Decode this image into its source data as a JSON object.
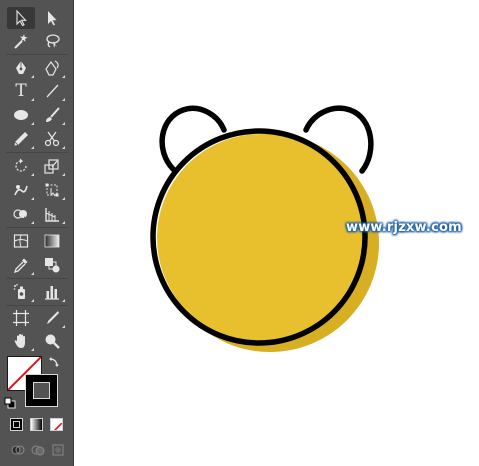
{
  "toolbar": {
    "tools": [
      {
        "name": "selection-tool",
        "icon": "selection-arrow-icon",
        "active": true
      },
      {
        "name": "direct-selection-tool",
        "icon": "direct-selection-arrow-icon"
      },
      {
        "name": "magic-wand-tool",
        "icon": "magic-wand-icon"
      },
      {
        "name": "lasso-tool",
        "icon": "lasso-icon"
      },
      {
        "name": "pen-tool",
        "icon": "pen-icon"
      },
      {
        "name": "curvature-tool",
        "icon": "curvature-pen-icon"
      },
      {
        "name": "type-tool",
        "icon": "type-icon",
        "glyph": "T"
      },
      {
        "name": "line-segment-tool",
        "icon": "line-segment-icon"
      },
      {
        "name": "ellipse-tool",
        "icon": "ellipse-icon"
      },
      {
        "name": "paintbrush-tool",
        "icon": "paintbrush-icon"
      },
      {
        "name": "pencil-tool",
        "icon": "pencil-icon"
      },
      {
        "name": "scissors-tool",
        "icon": "scissors-icon"
      },
      {
        "name": "rotate-tool",
        "icon": "rotate-icon"
      },
      {
        "name": "scale-tool",
        "icon": "scale-icon"
      },
      {
        "name": "warp-tool",
        "icon": "warp-icon"
      },
      {
        "name": "free-transform-tool",
        "icon": "free-transform-icon"
      },
      {
        "name": "shape-builder-tool",
        "icon": "shape-builder-icon"
      },
      {
        "name": "perspective-grid-tool",
        "icon": "perspective-grid-icon"
      },
      {
        "name": "mesh-tool",
        "icon": "mesh-icon"
      },
      {
        "name": "gradient-tool",
        "icon": "gradient-icon"
      },
      {
        "name": "eyedropper-tool",
        "icon": "eyedropper-icon"
      },
      {
        "name": "blend-tool",
        "icon": "blend-icon"
      },
      {
        "name": "symbol-sprayer-tool",
        "icon": "symbol-sprayer-icon"
      },
      {
        "name": "column-graph-tool",
        "icon": "column-graph-icon"
      },
      {
        "name": "artboard-tool",
        "icon": "artboard-icon"
      },
      {
        "name": "slice-tool",
        "icon": "slice-icon"
      },
      {
        "name": "hand-tool",
        "icon": "hand-icon"
      },
      {
        "name": "zoom-tool",
        "icon": "zoom-magnifier-icon"
      }
    ],
    "fill": {
      "color": "none",
      "swatch_bg": "#ffffff",
      "slash_color": "#e0141e"
    },
    "stroke": {
      "color": "#000000"
    },
    "modes": [
      "color",
      "gradient",
      "none"
    ],
    "draw_modes": [
      "draw-normal",
      "draw-behind",
      "draw-inside"
    ]
  },
  "artwork": {
    "head_fill": "#e8c02e",
    "shadow_fill": "#d8ae22",
    "outline": "#000000",
    "ear_fill": "#ffffff"
  },
  "watermark": {
    "text": "www.rjzxw.com",
    "outline_color": "#1f5fa8"
  }
}
